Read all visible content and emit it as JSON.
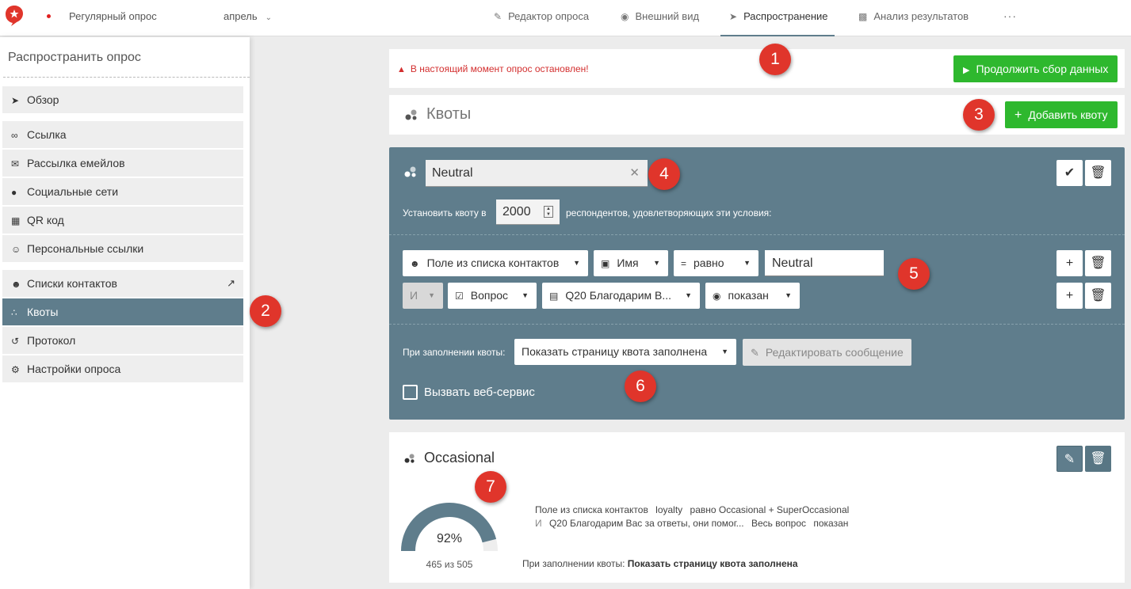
{
  "topbar": {
    "survey_name": "Регулярный опрос",
    "month": "апрель",
    "tabs": [
      {
        "label": "Редактор опроса",
        "icon": "edit-icon"
      },
      {
        "label": "Внешний вид",
        "icon": "palette-icon"
      },
      {
        "label": "Распространение",
        "icon": "send-icon",
        "active": true
      },
      {
        "label": "Анализ результатов",
        "icon": "bar-chart-icon"
      }
    ],
    "more": "···"
  },
  "sidebar": {
    "title": "Распространить опрос",
    "items": [
      {
        "label": "Обзор",
        "icon": "send-icon"
      },
      {
        "label": "Ссылка",
        "icon": "link-icon"
      },
      {
        "label": "Рассылка емейлов",
        "icon": "mail-icon"
      },
      {
        "label": "Социальные сети",
        "icon": "facebook-icon"
      },
      {
        "label": "QR код",
        "icon": "qr-icon"
      },
      {
        "label": "Персональные ссылки",
        "icon": "person-link-icon"
      },
      {
        "label": "Списки контактов",
        "icon": "contacts-icon"
      },
      {
        "label": "Квоты",
        "icon": "quota-icon",
        "active": true
      },
      {
        "label": "Протокол",
        "icon": "history-icon"
      },
      {
        "label": "Настройки опроса",
        "icon": "gear-icon"
      }
    ]
  },
  "markers": [
    "1",
    "2",
    "3",
    "4",
    "5",
    "6",
    "7"
  ],
  "status": {
    "warning": "В настоящий момент опрос остановлен!",
    "resume_button": "Продолжить сбор данных"
  },
  "quotas": {
    "title": "Квоты",
    "add_button": "Добавить квоту"
  },
  "editor": {
    "name": "Neutral",
    "set_prefix": "Установить квоту в",
    "count": "2000",
    "set_suffix": "респондентов, удовлетворяющих эти условия:",
    "row1": {
      "field": "Поле из списка контактов",
      "attribute": "Имя",
      "operator": "равно",
      "value": "Neutral"
    },
    "row2": {
      "logic": "И",
      "source": "Вопрос",
      "question": "Q20 Благодарим В...",
      "state": "показан"
    },
    "on_fill_label": "При заполнении квоты:",
    "on_fill_action": "Показать страницу квота заполнена",
    "edit_message": "Редактировать сообщение",
    "webservice_label": "Вызвать веб-сервис"
  },
  "occasional": {
    "title": "Occasional",
    "percent": "92%",
    "progress": 0.92,
    "count_text": "465 из 505",
    "cond1": {
      "field": "Поле из списка контактов",
      "attr": "loyalty",
      "expr": "равно Occasional + SuperOccasional"
    },
    "cond2": {
      "logic": "И",
      "question": "Q20 Благодарим Вас за ответы, они помог...",
      "scope": "Весь вопрос",
      "state": "показан"
    },
    "fill_label": "При заполнении квоты:",
    "fill_action": "Показать страницу квота заполнена"
  },
  "colors": {
    "accent": "#5f7d8c",
    "green": "#2eb82e",
    "warning": "#d32f2f",
    "marker": "#e0352b"
  }
}
